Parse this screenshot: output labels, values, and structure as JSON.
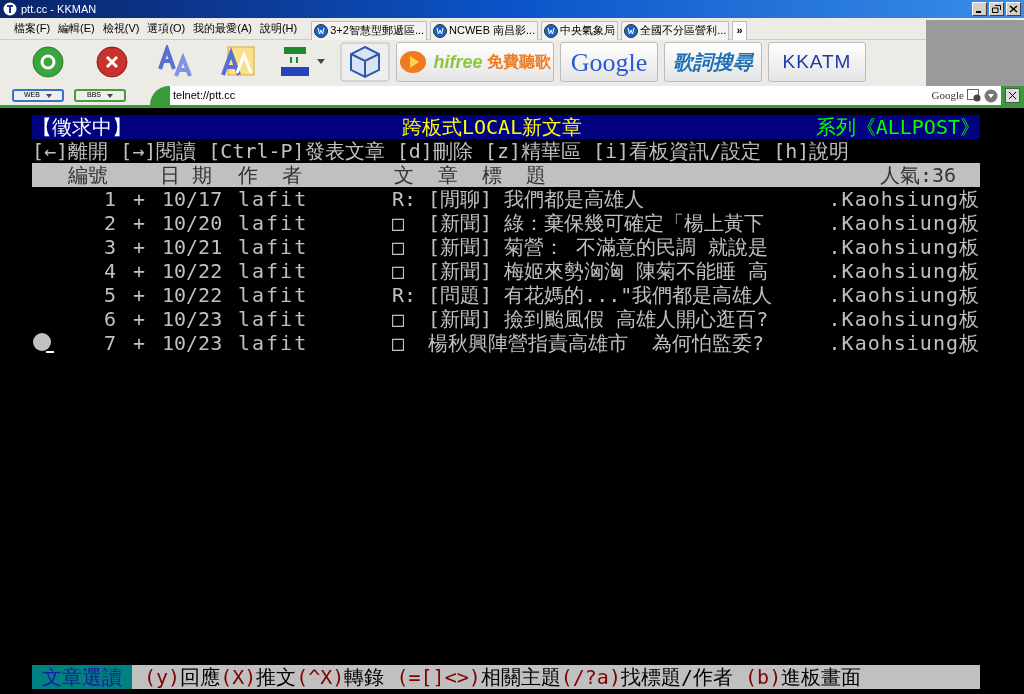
{
  "window": {
    "title": "ptt.cc - KKMAN"
  },
  "menu": [
    "檔案(F)",
    "編輯(E)",
    "檢視(V)",
    "選項(O)",
    "我的最愛(A)",
    "說明(H)"
  ],
  "tabs": [
    {
      "label": "3+2智慧型郵遞區...",
      "selected": false
    },
    {
      "label": "NCWEB 南昌影...",
      "selected": false
    },
    {
      "label": "中央氣象局",
      "selected": false
    },
    {
      "label": "全國不分區營利...",
      "selected": false
    }
  ],
  "tabs_more": "»",
  "toolbar_links": [
    {
      "kind": "hifree",
      "label": "hifree",
      "sub": "免費聽歌"
    },
    {
      "kind": "google",
      "label": "Google"
    },
    {
      "kind": "lyrics",
      "label": "歌詞搜尋"
    },
    {
      "kind": "kkatm",
      "label": "KKATM"
    }
  ],
  "address_bar": {
    "modes": [
      "WEB",
      "BBS"
    ],
    "value": "telnet://ptt.cc",
    "search_engine": "Google"
  },
  "terminal": {
    "header": {
      "left": "【徵求中】",
      "center": "跨板式LOCAL新文章",
      "right": "系列《ALLPOST》"
    },
    "keys": "[←]離開 [→]閱讀 [Ctrl-P]發表文章 [d]刪除 [z]精華區 [i]看板資訊/設定 [h]說明",
    "columns": [
      "編號",
      "日 期",
      "作  者",
      "文  章  標  題",
      "人氣:36"
    ],
    "posts": [
      {
        "num": "1",
        "mark": "+",
        "date": "10/17",
        "author": "lafit",
        "prefix": "R:",
        "title": "[閒聊] 我們都是高雄人",
        "board": ".Kaohsiung板",
        "selected": false
      },
      {
        "num": "2",
        "mark": "+",
        "date": "10/20",
        "author": "lafit",
        "prefix": "□",
        "title": "[新聞] 綠：棄保幾可確定「楊上黃下",
        "board": ".Kaohsiung板",
        "selected": false
      },
      {
        "num": "3",
        "mark": "+",
        "date": "10/21",
        "author": "lafit",
        "prefix": "□",
        "title": "[新聞] 菊營： 不滿意的民調 就說是",
        "board": ".Kaohsiung板",
        "selected": false
      },
      {
        "num": "4",
        "mark": "+",
        "date": "10/22",
        "author": "lafit",
        "prefix": "□",
        "title": "[新聞] 梅姬來勢洶洶 陳菊不能睡 高",
        "board": ".Kaohsiung板",
        "selected": false
      },
      {
        "num": "5",
        "mark": "+",
        "date": "10/22",
        "author": "lafit",
        "prefix": "R:",
        "title": "[問題] 有花媽的...\"我們都是高雄人",
        "board": ".Kaohsiung板",
        "selected": false
      },
      {
        "num": "6",
        "mark": "+",
        "date": "10/23",
        "author": "lafit",
        "prefix": "□",
        "title": "[新聞] 撿到颱風假 高雄人開心逛百?",
        "board": ".Kaohsiung板",
        "selected": false
      },
      {
        "num": "7",
        "mark": "+",
        "date": "10/23",
        "author": "lafit",
        "prefix": "□",
        "title": "楊秋興陣營指責高雄市  為何怕監委?",
        "board": ".Kaohsiung板",
        "selected": true
      }
    ],
    "status": {
      "mode": "文章選讀",
      "hints": [
        {
          "kind": "key",
          "text": "(y)"
        },
        {
          "kind": "label",
          "text": "回應"
        },
        {
          "kind": "key",
          "text": "(X)"
        },
        {
          "kind": "label",
          "text": "推文"
        },
        {
          "kind": "key",
          "text": "(^X)"
        },
        {
          "kind": "label",
          "text": "轉錄"
        },
        {
          "kind": "key",
          "text": " (=[]<>)"
        },
        {
          "kind": "label",
          "text": "相關主題"
        },
        {
          "kind": "key",
          "text": "(/?a)"
        },
        {
          "kind": "label",
          "text": "找標題/作者"
        },
        {
          "kind": "key",
          "text": " (b)"
        },
        {
          "kind": "label",
          "text": "進板畫面"
        }
      ]
    }
  }
}
